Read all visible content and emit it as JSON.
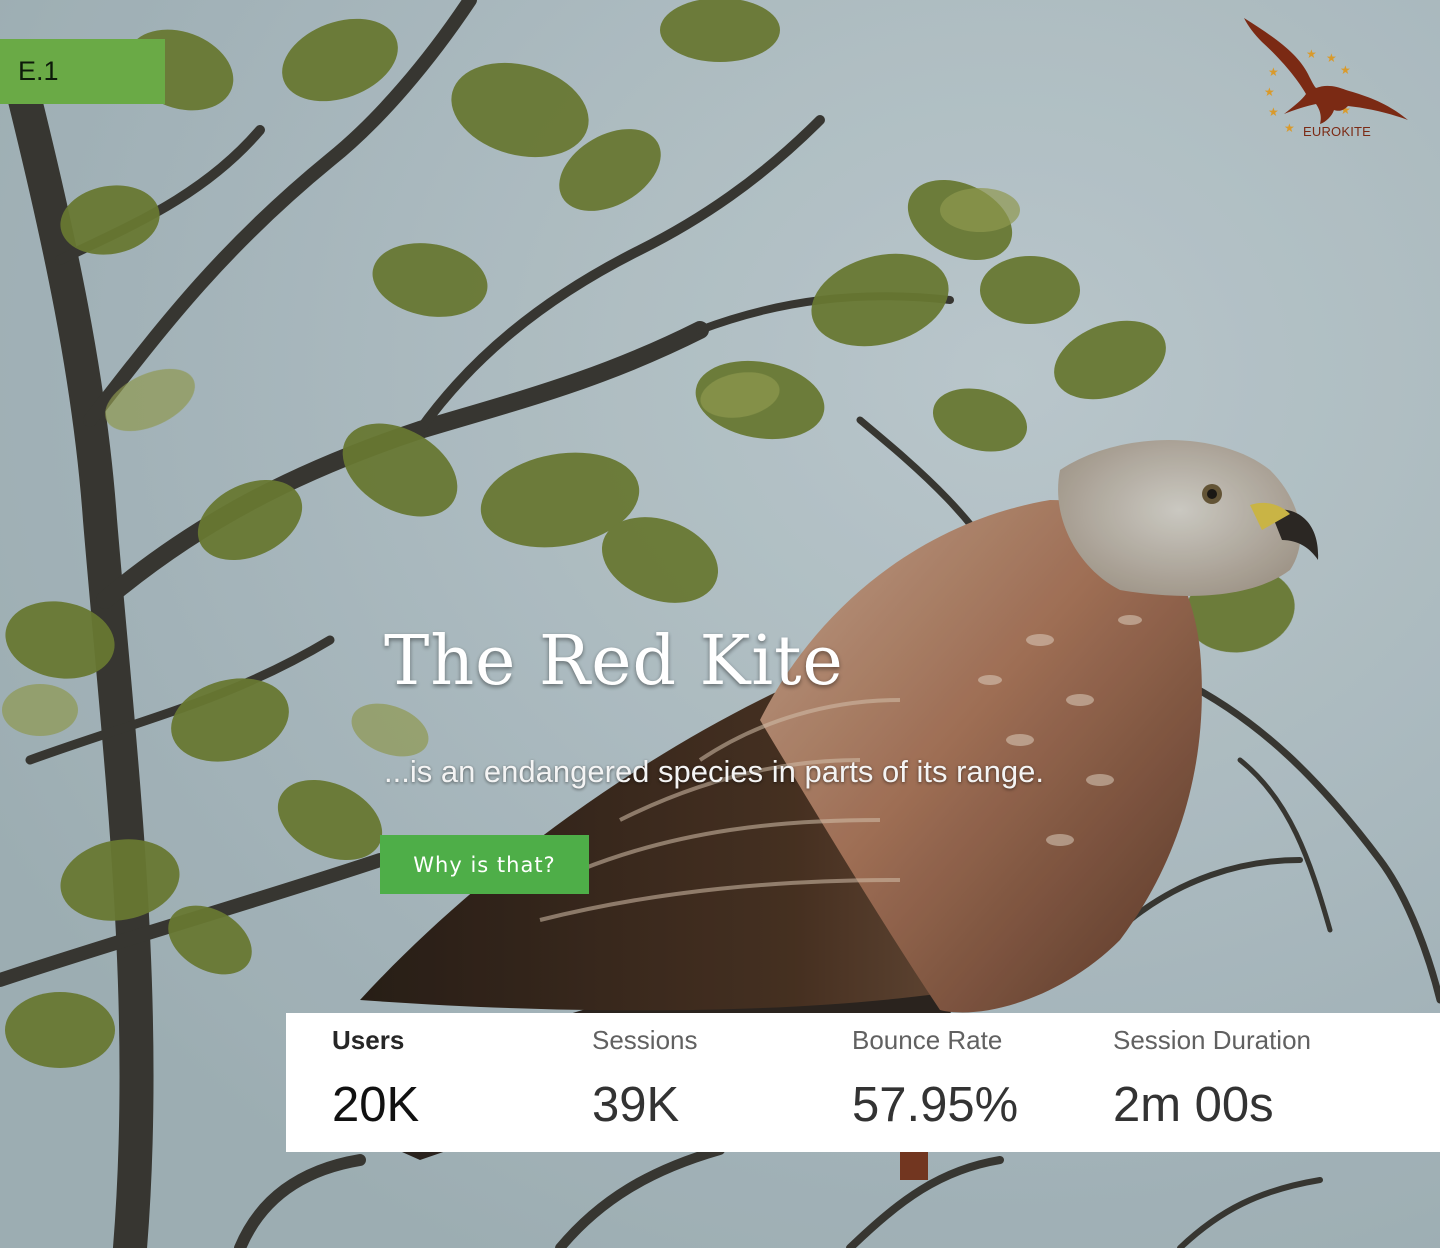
{
  "slide_tag": "E.1",
  "logo": {
    "text": "EUROKITE",
    "icon": "red-kite-eu-stars-logo",
    "color": "#7b2a14",
    "star_color": "#d99a2b"
  },
  "hero": {
    "title": "The Red Kite",
    "subtitle": "...is an endangered species in parts of its range.",
    "cta_label": "Why is that?",
    "cta_color": "#4eae48"
  },
  "stats": [
    {
      "label": "Users",
      "value": "20K"
    },
    {
      "label": "Sessions",
      "value": "39K"
    },
    {
      "label": "Bounce Rate",
      "value": "57.95%"
    },
    {
      "label": "Session Duration",
      "value": "2m 00s"
    }
  ]
}
